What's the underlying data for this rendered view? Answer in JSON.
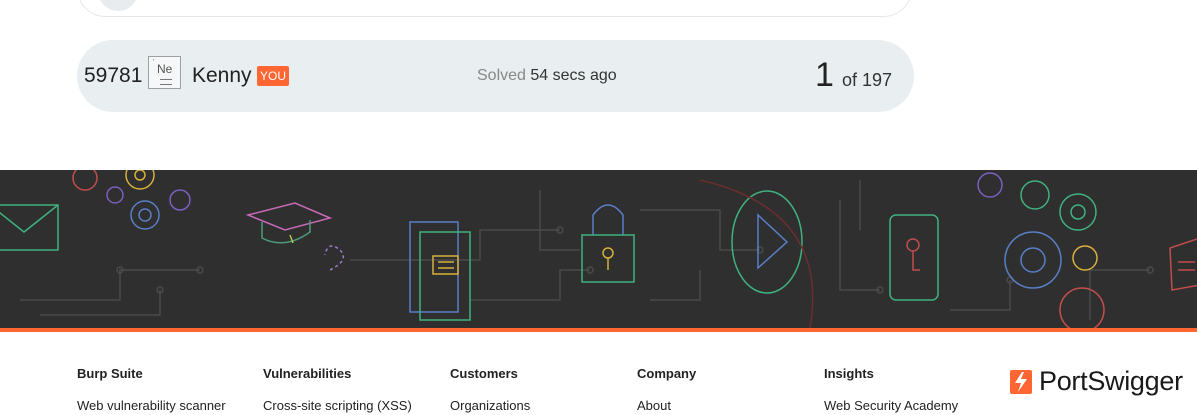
{
  "leaderboard": {
    "row": {
      "rank": "59781",
      "badge_symbol": "Ne",
      "username": "Kenny",
      "you_label": "YOU",
      "solved_label": "Solved",
      "solved_time": "54 secs ago",
      "place": "1",
      "of_total": "of 197"
    }
  },
  "banner": {
    "icons": [
      "envelope-icon",
      "gear-icon",
      "graduation-cap-icon",
      "book-icon",
      "padlock-icon",
      "play-icon",
      "phone-key-icon",
      "chat-bubble-icon"
    ],
    "colors": {
      "background": "#2f2f2f",
      "accent": "#ff6633"
    }
  },
  "footer": {
    "columns": [
      {
        "heading": "Burp Suite",
        "link": "Web vulnerability scanner"
      },
      {
        "heading": "Vulnerabilities",
        "link": "Cross-site scripting (XSS)"
      },
      {
        "heading": "Customers",
        "link": "Organizations"
      },
      {
        "heading": "Company",
        "link": "About"
      },
      {
        "heading": "Insights",
        "link": "Web Security Academy"
      }
    ],
    "logo_text": "PortSwigger"
  }
}
